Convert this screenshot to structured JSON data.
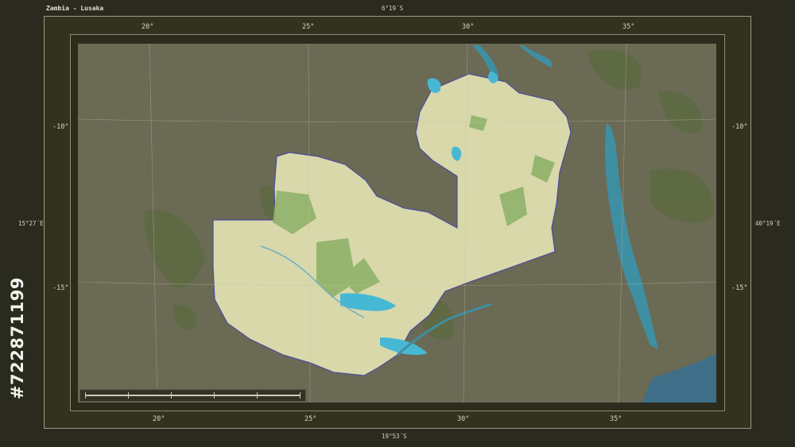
{
  "map_title": "Zambia - Lusaka",
  "frame": {
    "top_latitude": "6°19´S",
    "bottom_latitude": "19°53´S",
    "left_longitude": "15°27´E",
    "right_longitude": "40°19´E"
  },
  "longitude_ticks": [
    "20°",
    "25°",
    "30°",
    "35°"
  ],
  "latitude_ticks": [
    "-10°",
    "-15°"
  ],
  "stock_id": "#722871199",
  "colors": {
    "highlight_country": "#d8d8ab",
    "surrounding_land": "#6a6a55",
    "water": "#3f8fa3",
    "lake_bright": "#47b8d4",
    "forest": "#6f9a48",
    "border": "#4c4c9c"
  }
}
